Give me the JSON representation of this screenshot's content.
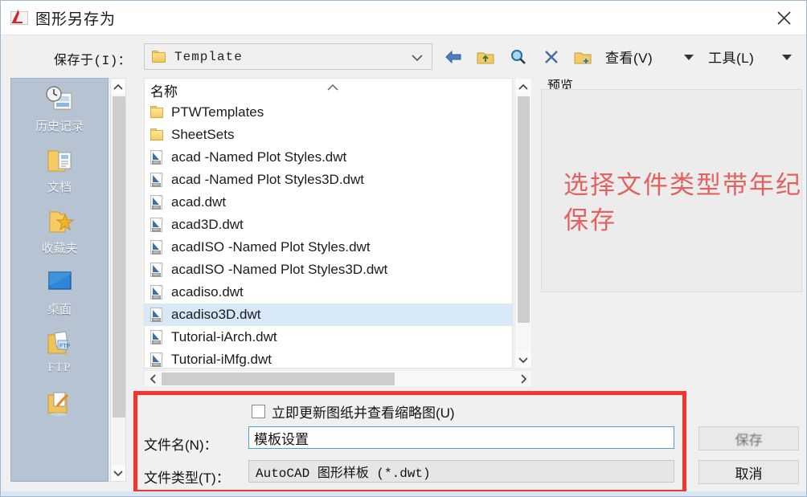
{
  "window": {
    "title": "图形另存为",
    "app_icon": "autocad-icon",
    "close_icon": "close-icon"
  },
  "toolbar": {
    "lookin_label": "保存于(I)：",
    "path_value": "Template",
    "path_icon": "folder-icon",
    "path_caret_icon": "chevron-down-icon",
    "buttons": [
      {
        "name": "back-button",
        "icon": "back-arrow-icon"
      },
      {
        "name": "up-folder-button",
        "icon": "up-folder-icon"
      },
      {
        "name": "search-button",
        "icon": "search-icon"
      },
      {
        "name": "delete-button",
        "icon": "close-x-icon"
      },
      {
        "name": "new-folder-button",
        "icon": "new-folder-icon"
      }
    ],
    "view_menu": "查看(V)",
    "tools_menu": "工具(L)",
    "view_caret_icon": "caret-down-icon",
    "tools_caret_icon": "caret-down-icon"
  },
  "places": {
    "items": [
      {
        "label": "历史记录",
        "icon": "history-icon"
      },
      {
        "label": "文档",
        "icon": "documents-folder-icon"
      },
      {
        "label": "收藏夹",
        "icon": "favorites-folder-icon"
      },
      {
        "label": "桌面",
        "icon": "desktop-icon"
      },
      {
        "label": "FTP",
        "icon": "ftp-folder-icon"
      },
      {
        "label": "",
        "icon": "buzzsaw-folder-icon"
      }
    ],
    "scroll_up_icon": "chevron-up-icon",
    "scroll_down_icon": "chevron-down-icon"
  },
  "filelist": {
    "column_header": "名称",
    "sort_icon": "caret-up-icon",
    "selected": "acadiso3D.dwt",
    "rows": [
      {
        "name": "PTWTemplates",
        "type": "folder"
      },
      {
        "name": "SheetSets",
        "type": "folder"
      },
      {
        "name": "acad -Named Plot Styles.dwt",
        "type": "dwt"
      },
      {
        "name": "acad -Named Plot Styles3D.dwt",
        "type": "dwt"
      },
      {
        "name": "acad.dwt",
        "type": "dwt"
      },
      {
        "name": "acad3D.dwt",
        "type": "dwt"
      },
      {
        "name": "acadISO -Named Plot Styles.dwt",
        "type": "dwt"
      },
      {
        "name": "acadISO -Named Plot Styles3D.dwt",
        "type": "dwt"
      },
      {
        "name": "acadiso.dwt",
        "type": "dwt"
      },
      {
        "name": "acadiso3D.dwt",
        "type": "dwt"
      },
      {
        "name": "Tutorial-iArch.dwt",
        "type": "dwt"
      },
      {
        "name": "Tutorial-iMfg.dwt",
        "type": "dwt"
      }
    ],
    "vscroll_up_icon": "chevron-up-icon",
    "vscroll_down_icon": "chevron-down-icon",
    "hscroll_left_icon": "chevron-left-icon",
    "hscroll_right_icon": "chevron-right-icon"
  },
  "preview": {
    "label": "预览",
    "annotation": "选择文件类型带年纪保存",
    "annotation_color": "#e1625e"
  },
  "form": {
    "update_thumbnail_label": "立即更新图纸并查看缩略图(U)",
    "update_thumbnail_checked": false,
    "filename_label": "文件名(N)：",
    "filename_value": "模板设置",
    "filetype_label": "文件类型(T)：",
    "filetype_value": "AutoCAD 图形样板 (*.dwt)",
    "save_button": "保存",
    "cancel_button": "取消",
    "highlight_color": "#f5332f"
  }
}
